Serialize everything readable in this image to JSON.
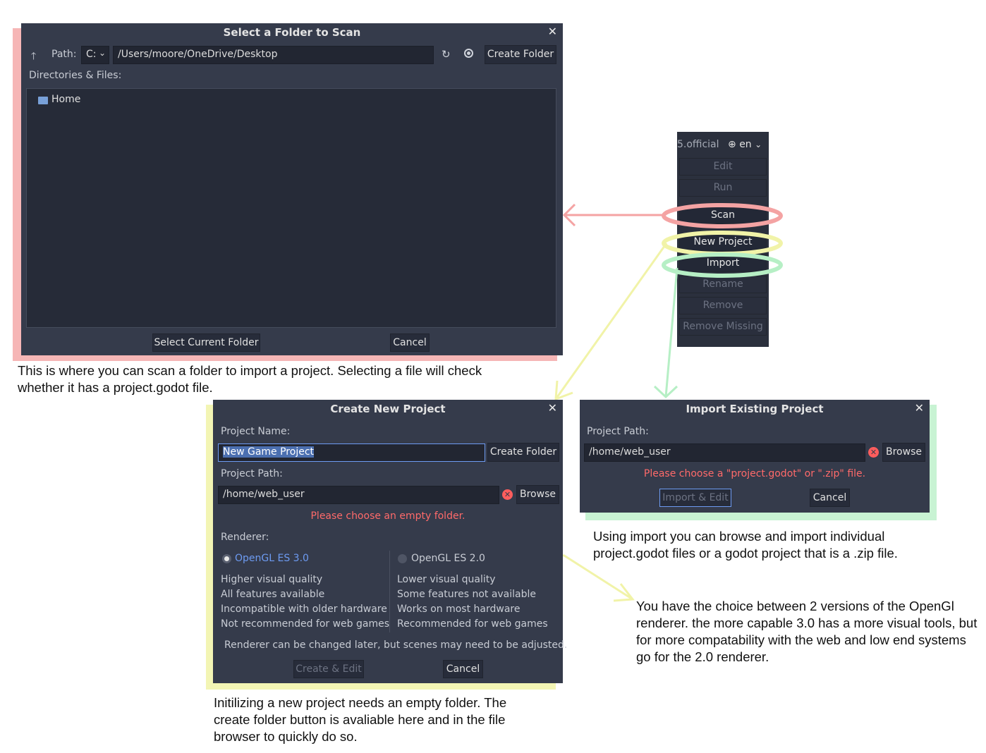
{
  "scan_dialog": {
    "title": "Select a Folder to Scan",
    "path_label": "Path:",
    "drive": "C:",
    "path_value": "/Users/moore/OneDrive/Desktop",
    "create_folder": "Create Folder",
    "dir_label": "Directories & Files:",
    "tree": [
      {
        "label": "Home"
      }
    ],
    "select_btn": "Select Current Folder",
    "cancel_btn": "Cancel",
    "close_icon": "close-icon"
  },
  "project_manager": {
    "version": "5.official",
    "lang": "en",
    "buttons": [
      {
        "label": "Edit",
        "enabled": false
      },
      {
        "label": "Run",
        "enabled": false
      },
      {
        "label": "Scan",
        "enabled": true
      },
      {
        "label": "New Project",
        "enabled": true
      },
      {
        "label": "Import",
        "enabled": true
      },
      {
        "label": "Rename",
        "enabled": false
      },
      {
        "label": "Remove",
        "enabled": false
      },
      {
        "label": "Remove Missing",
        "enabled": false
      }
    ]
  },
  "new_project": {
    "title": "Create New Project",
    "name_label": "Project Name:",
    "name_value": "New Game Project",
    "create_folder": "Create Folder",
    "path_label": "Project Path:",
    "path_value": "/home/web_user",
    "browse": "Browse",
    "error": "Please choose an empty folder.",
    "renderer_label": "Renderer:",
    "renderers": [
      {
        "name": "OpenGL ES 3.0",
        "selected": true,
        "lines": [
          "Higher visual quality",
          "All features available",
          "Incompatible with older hardware",
          "Not recommended for web games"
        ]
      },
      {
        "name": "OpenGL ES 2.0",
        "selected": false,
        "lines": [
          "Lower visual quality",
          "Some features not available",
          "Works on most hardware",
          "Recommended for web games"
        ]
      }
    ],
    "renderer_note": "Renderer can be changed later, but scenes may need to be adjusted.",
    "create_edit": "Create & Edit",
    "cancel": "Cancel"
  },
  "import_project": {
    "title": "Import Existing Project",
    "path_label": "Project Path:",
    "path_value": "/home/web_user",
    "browse": "Browse",
    "error": "Please choose a \"project.godot\" or \".zip\" file.",
    "import_edit": "Import & Edit",
    "cancel": "Cancel"
  },
  "annotations": {
    "scan": "This is where you can scan a folder to import a project. Selecting a file will check whether it has a project.godot file.",
    "import": "Using import you can browse and import individual project.godot files or a godot project that is a .zip file.",
    "renderer": "You have the choice between 2 versions of the OpenGl renderer. the more capable 3.0 has a more visual tools, but for more compatability with the web and low end systems go for the 2.0 renderer.",
    "new_project": "Initilizing a new project needs an empty folder. The create folder button is avaliable here and in the file browser to quickly do so."
  },
  "colors": {
    "dialog_bg": "#353b4b",
    "accent": "#6d9bf2",
    "error": "#ff6a6a",
    "highlight_red": "#f4a3a3",
    "highlight_yellow": "#f1f3a8",
    "highlight_green": "#b6efc5"
  }
}
